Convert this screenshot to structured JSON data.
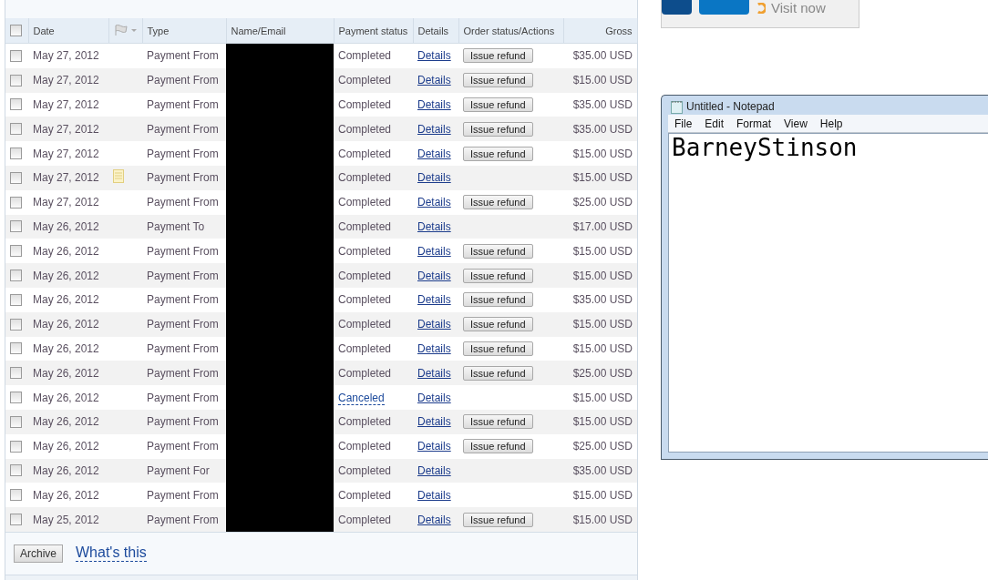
{
  "table": {
    "columns": [
      {
        "label": "Date"
      },
      {
        "label": "Type"
      },
      {
        "label": "Name/Email"
      },
      {
        "label": "Payment status"
      },
      {
        "label": "Details"
      },
      {
        "label": "Order status/Actions"
      },
      {
        "label": "Gross"
      }
    ],
    "header_checked": false,
    "rows": [
      {
        "checked": false,
        "date": "May 27, 2012",
        "note": false,
        "type": "Payment From",
        "status": "Completed",
        "status_link": false,
        "details": "Details",
        "action": "Issue refund",
        "gross": "$35.00 USD"
      },
      {
        "checked": false,
        "date": "May 27, 2012",
        "note": false,
        "type": "Payment From",
        "status": "Completed",
        "status_link": false,
        "details": "Details",
        "action": "Issue refund",
        "gross": "$15.00 USD"
      },
      {
        "checked": false,
        "date": "May 27, 2012",
        "note": false,
        "type": "Payment From",
        "status": "Completed",
        "status_link": false,
        "details": "Details",
        "action": "Issue refund",
        "gross": "$35.00 USD"
      },
      {
        "checked": false,
        "date": "May 27, 2012",
        "note": false,
        "type": "Payment From",
        "status": "Completed",
        "status_link": false,
        "details": "Details",
        "action": "Issue refund",
        "gross": "$35.00 USD"
      },
      {
        "checked": false,
        "date": "May 27, 2012",
        "note": false,
        "type": "Payment From",
        "status": "Completed",
        "status_link": false,
        "details": "Details",
        "action": "Issue refund",
        "gross": "$15.00 USD"
      },
      {
        "checked": false,
        "date": "May 27, 2012",
        "note": true,
        "type": "Payment From",
        "status": "Completed",
        "status_link": false,
        "details": "Details",
        "gross": "$15.00 USD"
      },
      {
        "checked": false,
        "date": "May 27, 2012",
        "note": false,
        "type": "Payment From",
        "status": "Completed",
        "status_link": false,
        "details": "Details",
        "action": "Issue refund",
        "gross": "$25.00 USD"
      },
      {
        "checked": false,
        "date": "May 26, 2012",
        "note": false,
        "type": "Payment To",
        "status": "Completed",
        "status_link": false,
        "details": "Details",
        "gross": "$17.00 USD"
      },
      {
        "checked": false,
        "date": "May 26, 2012",
        "note": false,
        "type": "Payment From",
        "status": "Completed",
        "status_link": false,
        "details": "Details",
        "action": "Issue refund",
        "gross": "$15.00 USD"
      },
      {
        "checked": false,
        "date": "May 26, 2012",
        "note": false,
        "type": "Payment From",
        "status": "Completed",
        "status_link": false,
        "details": "Details",
        "action": "Issue refund",
        "gross": "$15.00 USD"
      },
      {
        "checked": false,
        "date": "May 26, 2012",
        "note": false,
        "type": "Payment From",
        "status": "Completed",
        "status_link": false,
        "details": "Details",
        "action": "Issue refund",
        "gross": "$35.00 USD"
      },
      {
        "checked": false,
        "date": "May 26, 2012",
        "note": false,
        "type": "Payment From",
        "status": "Completed",
        "status_link": false,
        "details": "Details",
        "action": "Issue refund",
        "gross": "$15.00 USD"
      },
      {
        "checked": false,
        "date": "May 26, 2012",
        "note": false,
        "type": "Payment From",
        "status": "Completed",
        "status_link": false,
        "details": "Details",
        "action": "Issue refund",
        "gross": "$15.00 USD"
      },
      {
        "checked": false,
        "date": "May 26, 2012",
        "note": false,
        "type": "Payment From",
        "status": "Completed",
        "status_link": false,
        "details": "Details",
        "action": "Issue refund",
        "gross": "$25.00 USD"
      },
      {
        "checked": false,
        "date": "May 26, 2012",
        "note": false,
        "type": "Payment From",
        "status": "Canceled",
        "status_link": true,
        "details": "Details",
        "gross": "$15.00 USD"
      },
      {
        "checked": false,
        "date": "May 26, 2012",
        "note": false,
        "type": "Payment From",
        "status": "Completed",
        "status_link": false,
        "details": "Details",
        "action": "Issue refund",
        "gross": "$15.00 USD"
      },
      {
        "checked": false,
        "date": "May 26, 2012",
        "note": false,
        "type": "Payment From",
        "status": "Completed",
        "status_link": false,
        "details": "Details",
        "action": "Issue refund",
        "gross": "$25.00 USD"
      },
      {
        "checked": false,
        "date": "May 26, 2012",
        "note": false,
        "type": "Payment For",
        "status": "Completed",
        "status_link": false,
        "details": "Details",
        "gross": "$35.00 USD"
      },
      {
        "checked": false,
        "date": "May 26, 2012",
        "note": false,
        "type": "Payment From",
        "status": "Completed",
        "status_link": false,
        "details": "Details",
        "gross": "$15.00 USD"
      },
      {
        "checked": false,
        "date": "May 25, 2012",
        "note": false,
        "type": "Payment From",
        "status": "Completed",
        "status_link": false,
        "details": "Details",
        "action": "Issue refund",
        "gross": "$15.00 USD"
      }
    ]
  },
  "footer": {
    "button": "Archive",
    "link": "What's this"
  },
  "ad": {
    "link": "Visit now"
  },
  "notepad": {
    "title": "Untitled - Notepad",
    "menu": [
      "File",
      "Edit",
      "Format",
      "View",
      "Help"
    ],
    "text": "BarneyStinson"
  }
}
